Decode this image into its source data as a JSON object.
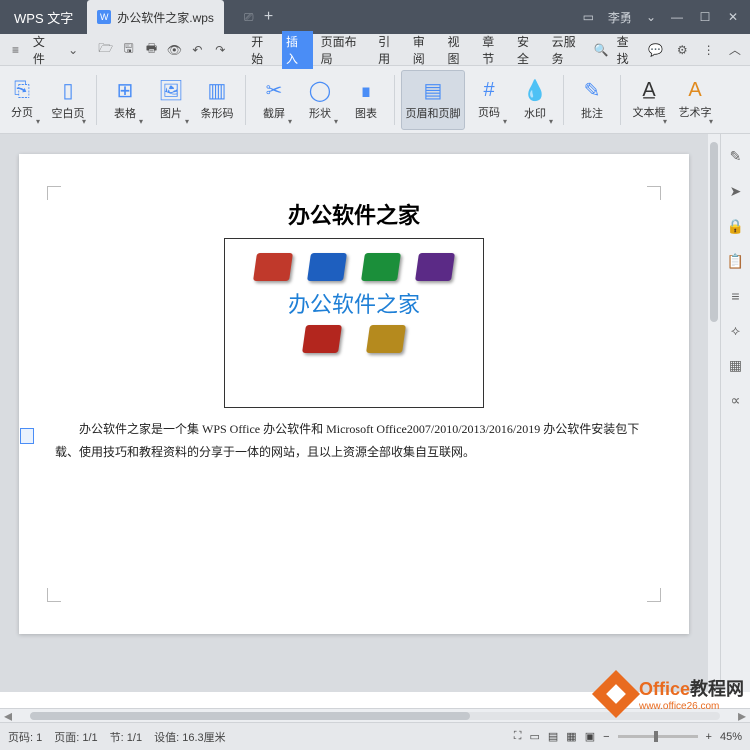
{
  "app_name": "WPS 文字",
  "tab": {
    "icon_letter": "W",
    "filename": "办公软件之家.wps"
  },
  "titlebar": {
    "screen_icon": "⎚",
    "user": "李勇",
    "min": "—",
    "max": "☐",
    "close": "✕"
  },
  "file_menu": {
    "hamburger": "≡",
    "label": "文件",
    "caret": "⌄"
  },
  "quick_icons": [
    "folder-open-icon",
    "save-icon",
    "print-icon",
    "preview-icon",
    "undo-icon",
    "redo-icon"
  ],
  "menus": [
    "开始",
    "插入",
    "页面布局",
    "引用",
    "审阅",
    "视图",
    "章节",
    "安全",
    "云服务"
  ],
  "active_menu_index": 1,
  "search": {
    "icon": "🔍",
    "label": "查找"
  },
  "menu_right_icons": [
    "chat-icon",
    "gear-icon",
    "more-icon",
    "collapse-icon"
  ],
  "ribbon": [
    {
      "label": "分页",
      "caret": true
    },
    {
      "label": "空白页",
      "caret": true
    },
    {
      "sep": true
    },
    {
      "label": "表格",
      "caret": true
    },
    {
      "label": "图片",
      "caret": true
    },
    {
      "label": "条形码"
    },
    {
      "sep": true
    },
    {
      "label": "截屏",
      "caret": true
    },
    {
      "label": "形状",
      "caret": true
    },
    {
      "label": "图表"
    },
    {
      "sep": true
    },
    {
      "label": "页眉和页脚",
      "active": true,
      "wide": true
    },
    {
      "label": "页码",
      "caret": true
    },
    {
      "label": "水印",
      "caret": true
    },
    {
      "sep": true
    },
    {
      "label": "批注"
    },
    {
      "sep": true
    },
    {
      "label": "文本框",
      "caret": true
    },
    {
      "label": "艺术字",
      "caret": true
    }
  ],
  "right_panel_icons": [
    "pencil-icon",
    "cursor-icon",
    "lock-icon",
    "clipboard-icon",
    "list-icon",
    "ruler-icon",
    "properties-icon",
    "share-icon"
  ],
  "document": {
    "title": "办公软件之家",
    "logo_text": "办公软件之家",
    "paragraph": "办公软件之家是一个集 WPS Office 办公软件和 Microsoft Office2007/2010/2013/2016/2019 办公软件安装包下载、使用技巧和教程资料的分享于一体的网站，且以上资源全部收集自互联网。"
  },
  "status": {
    "page_code_label": "页码:",
    "page_code": "1",
    "page_label": "页面:",
    "page": "1/1",
    "section_label": "节:",
    "section": "1/1",
    "setting_label": "设值:",
    "setting": "16.3厘米",
    "zoom": "45%"
  },
  "watermark": {
    "brand": "Office",
    "suffix": "教程网",
    "url": "www.office26.com"
  },
  "icon_colors": [
    "#c0392b",
    "#1e5fbf",
    "#1b8f3a",
    "#5b2a86",
    "#b3261e",
    "#b58a1e"
  ]
}
